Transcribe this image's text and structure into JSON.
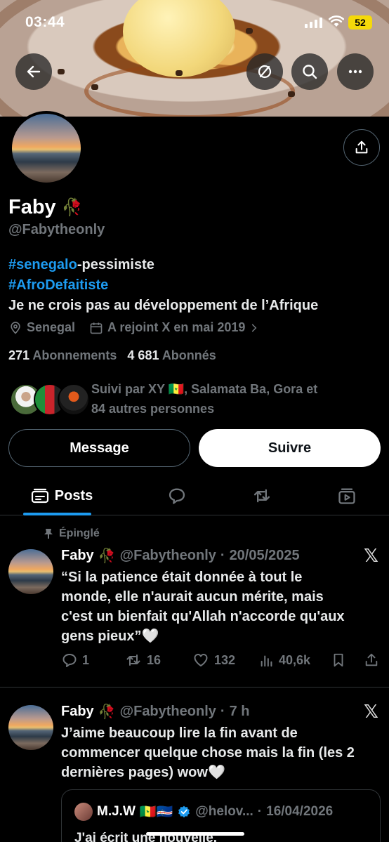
{
  "statusbar": {
    "time": "03:44",
    "battery": "52"
  },
  "header": {
    "back_icon": "arrow-left-icon",
    "grok_icon": "slash-circle-icon",
    "search_icon": "search-icon",
    "more_icon": "more-horizontal-icon"
  },
  "profile": {
    "name": "Faby",
    "name_emoji": "🥀",
    "handle": "@Fabytheonly",
    "bio_tag1": "#senegalo",
    "bio_tag1_rest": "-pessimiste",
    "bio_tag2": "#AfroDefaitiste",
    "bio_line3": "Je ne crois pas au développement de l’Afrique",
    "location": "Senegal",
    "joined": "A rejoint X en mai 2019",
    "following_count": "271",
    "following_label": "Abonnements",
    "followers_count": "4 681",
    "followers_label": "Abonnés",
    "followed_by_line1": "Suivi par XY 🇸🇳, Salamata Ba, Gora et",
    "followed_by_line2": "84 autres personnes",
    "message_button": "Message",
    "follow_button": "Suivre"
  },
  "tabs": {
    "posts_label": "Posts"
  },
  "posts": [
    {
      "pinned_label": "Épinglé",
      "name": "Faby",
      "emoji": "🥀",
      "handle": "@Fabytheonly",
      "sep": "·",
      "date": "20/05/2025",
      "line1": "“Si la patience était donnée à tout le",
      "line2": "monde, elle n'aurait aucun mérite, mais",
      "line3": "c'est un bienfait qu'Allah n'accorde qu'aux",
      "line4": "gens pieux”🤍",
      "replies": "1",
      "reposts": "16",
      "likes": "132",
      "views": "40,6k"
    },
    {
      "name": "Faby",
      "emoji": "🥀",
      "handle": "@Fabytheonly",
      "sep": "·",
      "date": "7 h",
      "line1": "J’aime beaucoup lire la fin avant de",
      "line2": "commencer quelque chose mais la fin (les 2",
      "line3": "dernières pages) wow🤍",
      "quote": {
        "name": "M.J.W",
        "flags": "🇸🇳🇨🇻",
        "handle": "@helov...",
        "sep": "·",
        "date": "16/04/2026",
        "text": "J'ai écrit une nouvelle."
      }
    }
  ]
}
